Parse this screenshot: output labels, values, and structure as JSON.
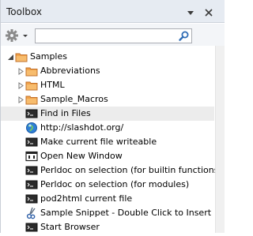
{
  "panel": {
    "title": "Toolbox",
    "dropdown_icon": "chevron-down-icon",
    "close_icon": "close-icon"
  },
  "toolbar": {
    "settings_icon": "gear-icon",
    "search": {
      "value": "",
      "placeholder": ""
    },
    "search_icon": "search-icon"
  },
  "tree": {
    "items": [
      {
        "label": "Samples",
        "type": "folder",
        "expanded": true
      },
      {
        "label": "Abbreviations",
        "type": "folder",
        "expanded": false
      },
      {
        "label": "HTML",
        "type": "folder",
        "expanded": false
      },
      {
        "label": "Sample_Macros",
        "type": "folder",
        "expanded": false
      },
      {
        "label": "Find in Files",
        "type": "command",
        "selected": true
      },
      {
        "label": "http://slashdot.org/",
        "type": "url"
      },
      {
        "label": "Make current file writeable",
        "type": "command"
      },
      {
        "label": "Open New Window",
        "type": "window"
      },
      {
        "label": "Perldoc on selection (for builtin functions)",
        "type": "command"
      },
      {
        "label": "Perldoc on selection (for modules)",
        "type": "command"
      },
      {
        "label": "pod2html current file",
        "type": "command"
      },
      {
        "label": "Sample Snippet - Double Click to Insert",
        "type": "snippet"
      },
      {
        "label": "Start Browser",
        "type": "command"
      }
    ]
  },
  "colors": {
    "folder": "#f0a24a",
    "selection": "#ececec",
    "titlebar": "#e6ebf2"
  }
}
